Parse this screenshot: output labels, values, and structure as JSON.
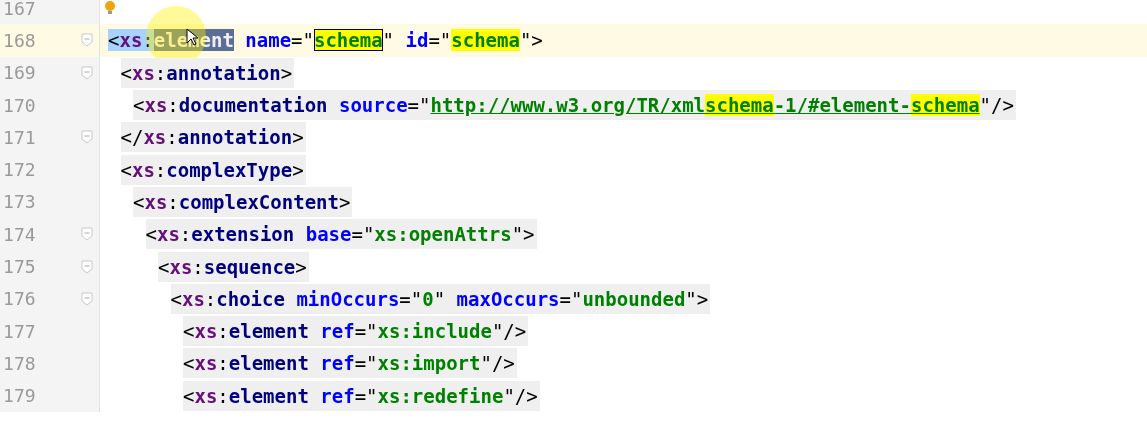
{
  "editor": {
    "lines": [
      {
        "number": "167",
        "fold": false,
        "bulb": true
      },
      {
        "number": "168",
        "fold": true,
        "current": true,
        "tokens": [
          {
            "t": "<",
            "kind": "punct",
            "selected": true
          },
          {
            "t": "xs",
            "kind": "ns",
            "selected": true
          },
          {
            "t": ":",
            "kind": "punct",
            "selected": true
          },
          {
            "t": "element",
            "kind": "tag",
            "caret": true
          },
          {
            "t": "name",
            "kind": "attr",
            "space_before": true
          },
          {
            "t": "=\"",
            "kind": "punct"
          },
          {
            "t": "schema",
            "kind": "value",
            "match": true,
            "boxed": true
          },
          {
            "t": "\"",
            "kind": "punct"
          },
          {
            "t": "id",
            "kind": "attr",
            "space_before": true
          },
          {
            "t": "=\"",
            "kind": "punct"
          },
          {
            "t": "schema",
            "kind": "value",
            "match": true
          },
          {
            "t": "\">",
            "kind": "punct"
          }
        ],
        "children": [
          {
            "number": "169",
            "fold": true,
            "tokens": [
              {
                "t": "<",
                "kind": "punct"
              },
              {
                "t": "xs",
                "kind": "ns"
              },
              {
                "t": ":",
                "kind": "punct"
              },
              {
                "t": "annotation",
                "kind": "tag"
              },
              {
                "t": ">",
                "kind": "punct"
              }
            ],
            "children": [
              {
                "number": "170",
                "fold": false,
                "tokens": [
                  {
                    "t": "<",
                    "kind": "punct"
                  },
                  {
                    "t": "xs",
                    "kind": "ns"
                  },
                  {
                    "t": ":",
                    "kind": "punct"
                  },
                  {
                    "t": "documentation",
                    "kind": "tag"
                  },
                  {
                    "t": "source",
                    "kind": "attr",
                    "space_before": true
                  },
                  {
                    "t": "=\"",
                    "kind": "punct"
                  },
                  {
                    "t": "http://www.w3.org/TR/xml",
                    "kind": "link"
                  },
                  {
                    "t": "schema",
                    "kind": "link",
                    "match": true
                  },
                  {
                    "t": "-1/#element-",
                    "kind": "link"
                  },
                  {
                    "t": "schema",
                    "kind": "link",
                    "match": true
                  },
                  {
                    "t": "\"/>",
                    "kind": "punct"
                  }
                ]
              }
            ]
          },
          {
            "number": "171",
            "fold": true,
            "tokens": [
              {
                "t": "</",
                "kind": "punct"
              },
              {
                "t": "xs",
                "kind": "ns"
              },
              {
                "t": ":",
                "kind": "punct"
              },
              {
                "t": "annotation",
                "kind": "tag"
              },
              {
                "t": ">",
                "kind": "punct"
              }
            ]
          },
          {
            "number": "172",
            "fold": false,
            "tokens": [
              {
                "t": "<",
                "kind": "punct"
              },
              {
                "t": "xs",
                "kind": "ns"
              },
              {
                "t": ":",
                "kind": "punct"
              },
              {
                "t": "complexType",
                "kind": "tag"
              },
              {
                "t": ">",
                "kind": "punct"
              }
            ],
            "children": [
              {
                "number": "173",
                "fold": false,
                "tokens": [
                  {
                    "t": "<",
                    "kind": "punct"
                  },
                  {
                    "t": "xs",
                    "kind": "ns"
                  },
                  {
                    "t": ":",
                    "kind": "punct"
                  },
                  {
                    "t": "complexContent",
                    "kind": "tag"
                  },
                  {
                    "t": ">",
                    "kind": "punct"
                  }
                ],
                "children": [
                  {
                    "number": "174",
                    "fold": true,
                    "tokens": [
                      {
                        "t": "<",
                        "kind": "punct"
                      },
                      {
                        "t": "xs",
                        "kind": "ns"
                      },
                      {
                        "t": ":",
                        "kind": "punct"
                      },
                      {
                        "t": "extension",
                        "kind": "tag"
                      },
                      {
                        "t": "base",
                        "kind": "attr",
                        "space_before": true
                      },
                      {
                        "t": "=\"",
                        "kind": "punct"
                      },
                      {
                        "t": "xs:openAttrs",
                        "kind": "value"
                      },
                      {
                        "t": "\">",
                        "kind": "punct"
                      }
                    ],
                    "children": [
                      {
                        "number": "175",
                        "fold": true,
                        "tokens": [
                          {
                            "t": "<",
                            "kind": "punct"
                          },
                          {
                            "t": "xs",
                            "kind": "ns"
                          },
                          {
                            "t": ":",
                            "kind": "punct"
                          },
                          {
                            "t": "sequence",
                            "kind": "tag"
                          },
                          {
                            "t": ">",
                            "kind": "punct"
                          }
                        ],
                        "children": [
                          {
                            "number": "176",
                            "fold": true,
                            "tokens": [
                              {
                                "t": "<",
                                "kind": "punct"
                              },
                              {
                                "t": "xs",
                                "kind": "ns"
                              },
                              {
                                "t": ":",
                                "kind": "punct"
                              },
                              {
                                "t": "choice",
                                "kind": "tag"
                              },
                              {
                                "t": "minOccurs",
                                "kind": "attr",
                                "space_before": true
                              },
                              {
                                "t": "=\"",
                                "kind": "punct"
                              },
                              {
                                "t": "0",
                                "kind": "value"
                              },
                              {
                                "t": "\"",
                                "kind": "punct"
                              },
                              {
                                "t": "maxOccurs",
                                "kind": "attr",
                                "space_before": true
                              },
                              {
                                "t": "=\"",
                                "kind": "punct"
                              },
                              {
                                "t": "unbounded",
                                "kind": "value"
                              },
                              {
                                "t": "\">",
                                "kind": "punct"
                              }
                            ],
                            "children": [
                              {
                                "number": "177",
                                "fold": false,
                                "tokens": [
                                  {
                                    "t": "<",
                                    "kind": "punct"
                                  },
                                  {
                                    "t": "xs",
                                    "kind": "ns"
                                  },
                                  {
                                    "t": ":",
                                    "kind": "punct"
                                  },
                                  {
                                    "t": "element",
                                    "kind": "tag"
                                  },
                                  {
                                    "t": "ref",
                                    "kind": "attr",
                                    "space_before": true
                                  },
                                  {
                                    "t": "=\"",
                                    "kind": "punct"
                                  },
                                  {
                                    "t": "xs:include",
                                    "kind": "value"
                                  },
                                  {
                                    "t": "\"/>",
                                    "kind": "punct"
                                  }
                                ]
                              },
                              {
                                "number": "178",
                                "fold": false,
                                "tokens": [
                                  {
                                    "t": "<",
                                    "kind": "punct"
                                  },
                                  {
                                    "t": "xs",
                                    "kind": "ns"
                                  },
                                  {
                                    "t": ":",
                                    "kind": "punct"
                                  },
                                  {
                                    "t": "element",
                                    "kind": "tag"
                                  },
                                  {
                                    "t": "ref",
                                    "kind": "attr",
                                    "space_before": true
                                  },
                                  {
                                    "t": "=\"",
                                    "kind": "punct"
                                  },
                                  {
                                    "t": "xs:import",
                                    "kind": "value"
                                  },
                                  {
                                    "t": "\"/>",
                                    "kind": "punct"
                                  }
                                ]
                              },
                              {
                                "number": "179",
                                "fold": false,
                                "tokens": [
                                  {
                                    "t": "<",
                                    "kind": "punct"
                                  },
                                  {
                                    "t": "xs",
                                    "kind": "ns"
                                  },
                                  {
                                    "t": ":",
                                    "kind": "punct"
                                  },
                                  {
                                    "t": "element",
                                    "kind": "tag"
                                  },
                                  {
                                    "t": "ref",
                                    "kind": "attr",
                                    "space_before": true
                                  },
                                  {
                                    "t": "=\"",
                                    "kind": "punct"
                                  },
                                  {
                                    "t": "xs:redefine",
                                    "kind": "value"
                                  },
                                  {
                                    "t": "\"/>",
                                    "kind": "punct"
                                  }
                                ]
                              }
                            ]
                          }
                        ]
                      }
                    ]
                  }
                ]
              }
            ]
          }
        ]
      }
    ]
  }
}
